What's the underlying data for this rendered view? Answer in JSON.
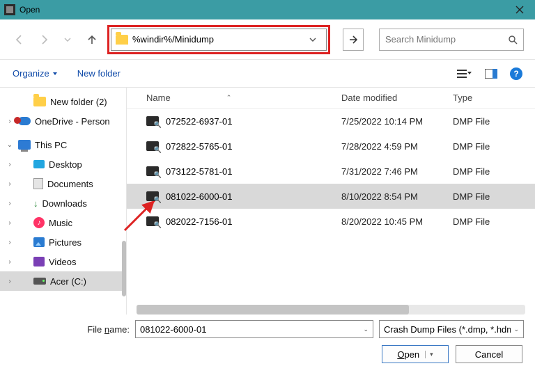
{
  "titlebar": {
    "title": "Open"
  },
  "nav": {
    "path": "%windir%/Minidump",
    "search_placeholder": "Search Minidump"
  },
  "toolbar": {
    "organize": "Organize",
    "new_folder": "New folder"
  },
  "sidebar": {
    "new_folder": "New folder (2)",
    "onedrive": "OneDrive - Person",
    "this_pc": "This PC",
    "desktop": "Desktop",
    "documents": "Documents",
    "downloads": "Downloads",
    "music": "Music",
    "pictures": "Pictures",
    "videos": "Videos",
    "drive_c": "Acer (C:)"
  },
  "columns": {
    "name": "Name",
    "date": "Date modified",
    "type": "Type"
  },
  "files": [
    {
      "name": "072522-6937-01",
      "date": "7/25/2022 10:14 PM",
      "type": "DMP File"
    },
    {
      "name": "072822-5765-01",
      "date": "7/28/2022 4:59 PM",
      "type": "DMP File"
    },
    {
      "name": "073122-5781-01",
      "date": "7/31/2022 7:46 PM",
      "type": "DMP File"
    },
    {
      "name": "081022-6000-01",
      "date": "8/10/2022 8:54 PM",
      "type": "DMP File"
    },
    {
      "name": "082022-7156-01",
      "date": "8/20/2022 10:45 PM",
      "type": "DMP File"
    }
  ],
  "selected_row_index": 3,
  "footer": {
    "file_name_label": "File name:",
    "file_name_value": "081022-6000-01",
    "filter": "Crash Dump Files (*.dmp, *.hdm",
    "open": "Open",
    "cancel": "Cancel"
  }
}
